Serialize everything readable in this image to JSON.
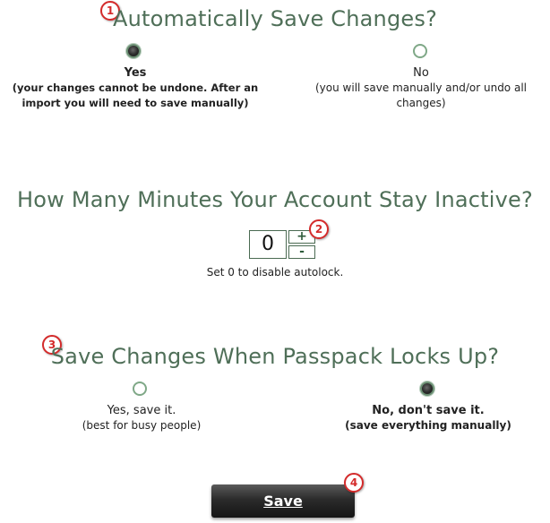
{
  "section1": {
    "badge": "1",
    "heading": "Automatically Save Changes?",
    "options": [
      {
        "label": "Yes",
        "note": "(your changes cannot be undone. After an import you will need to save manually)",
        "selected": true
      },
      {
        "label": "No",
        "note": "(you will save manually and/or undo all changes)",
        "selected": false
      }
    ]
  },
  "section2": {
    "heading": "How Many Minutes Your Account Stay Inactive?",
    "minutes_value": "0",
    "increment_label": "+",
    "decrement_label": "-",
    "badge": "2",
    "hint": "Set 0 to disable autolock."
  },
  "section3": {
    "badge": "3",
    "heading": "Save Changes When Passpack Locks Up?",
    "options": [
      {
        "label": "Yes, save it.",
        "note": "(best for busy people)",
        "selected": false
      },
      {
        "label": "No, don't save it.",
        "note": "(save everything manually)",
        "selected": true
      }
    ]
  },
  "save": {
    "label": "Save",
    "badge": "4"
  },
  "colors": {
    "heading": "#4f6f58",
    "badge": "#d42b2b",
    "radio_border": "#7fa887"
  }
}
